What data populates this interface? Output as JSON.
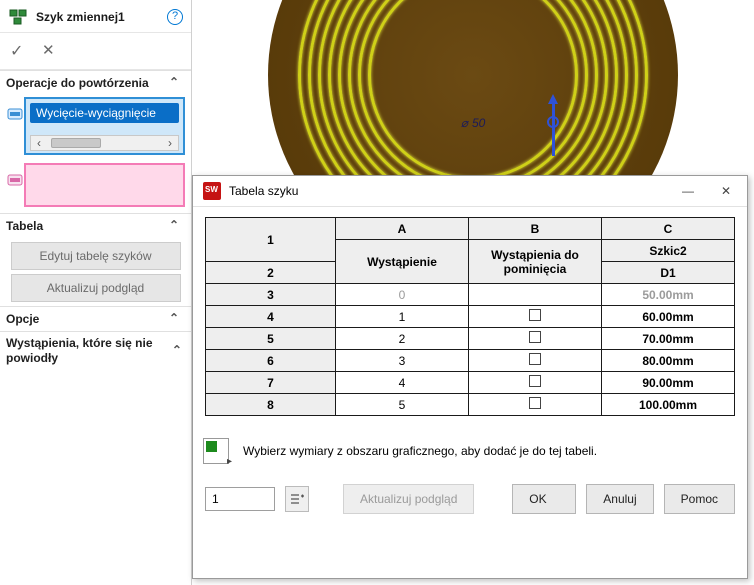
{
  "pm": {
    "title": "Szyk zmiennej1",
    "sections": {
      "ops": "Operacje do powtórzenia",
      "table": "Tabela",
      "options": "Opcje",
      "failed": "Wystąpienia, które się nie powiodły"
    },
    "feature_item": "Wycięcie-wyciągnięcie",
    "buttons": {
      "edit_table": "Edytuj tabelę szyków",
      "update_preview": "Aktualizuj podgląd"
    }
  },
  "viewport": {
    "dimension_label": "50"
  },
  "dialog": {
    "title": "Tabela szyku",
    "col_letters": [
      "A",
      "B",
      "C"
    ],
    "headers": {
      "instance": "Wystąpienie",
      "skip": "Wystąpienia do pominięcia",
      "sketch": "Szkic2",
      "sketch_sub": "D1"
    },
    "rows": [
      {
        "n": "3",
        "inst": "0",
        "skip": "",
        "d1": "50.00mm",
        "base": true
      },
      {
        "n": "4",
        "inst": "1",
        "skip": "cb",
        "d1": "60.00mm"
      },
      {
        "n": "5",
        "inst": "2",
        "skip": "cb",
        "d1": "70.00mm"
      },
      {
        "n": "6",
        "inst": "3",
        "skip": "cb",
        "d1": "80.00mm"
      },
      {
        "n": "7",
        "inst": "4",
        "skip": "cb",
        "d1": "90.00mm"
      },
      {
        "n": "8",
        "inst": "5",
        "skip": "cb",
        "d1": "100.00mm"
      }
    ],
    "head_row_1": "1",
    "head_row_2": "2",
    "hint": "Wybierz wymiary z obszaru graficznego, aby dodać je do tej tabeli.",
    "spinner_value": "1",
    "buttons": {
      "update": "Aktualizuj podgląd",
      "ok": "OK",
      "cancel": "Anuluj",
      "help": "Pomoc"
    }
  }
}
